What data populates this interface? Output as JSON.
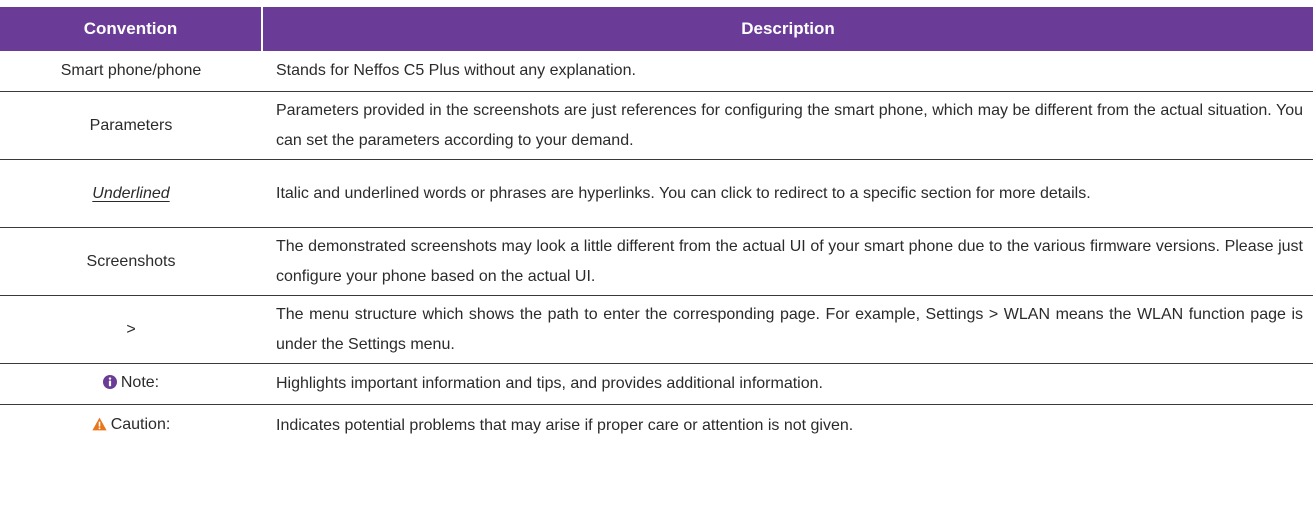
{
  "table": {
    "headers": {
      "convention": "Convention",
      "description": "Description"
    },
    "rows": [
      {
        "convention": "Smart phone/phone",
        "description": "Stands for Neffos C5 Plus without any explanation."
      },
      {
        "convention": "Parameters",
        "description": "Parameters provided in the screenshots are just references for configuring the smart phone, which may be different from the actual situation. You can set the parameters according to your demand."
      },
      {
        "convention": "Underlined",
        "description": "Italic and underlined words or phrases are hyperlinks. You can click to redirect to a specific section for more details."
      },
      {
        "convention": "Screenshots",
        "description": "The demonstrated screenshots may look a little different from the actual UI of your smart phone due to the various firmware versions. Please just configure your phone based on the actual UI."
      },
      {
        "convention": ">",
        "description": "The menu structure which shows the path to enter the corresponding page. For example, Settings > WLAN means the WLAN function page is under the Settings menu."
      },
      {
        "convention": "Note:",
        "icon": "info-icon",
        "description": "Highlights important information and tips, and provides additional information."
      },
      {
        "convention": "Caution:",
        "icon": "warning-icon",
        "description": "Indicates potential problems that may arise if proper care or attention is not given."
      }
    ]
  },
  "colors": {
    "header_background": "#6a3b97",
    "header_text": "#ffffff",
    "info_icon": "#6a3b97",
    "warning_icon": "#e8761a"
  }
}
